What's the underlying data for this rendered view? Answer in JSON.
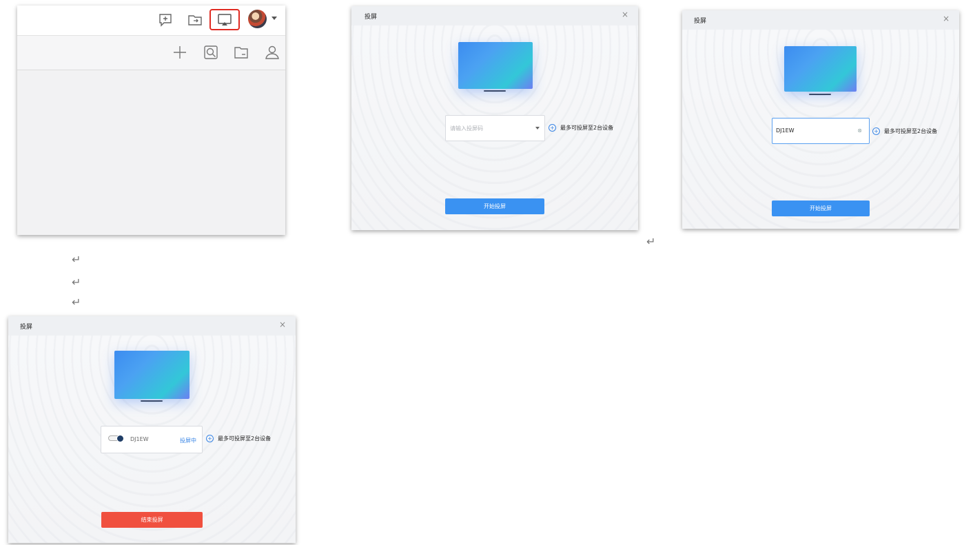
{
  "panel_app": {
    "toolbar_icons": [
      "new-chat-icon",
      "folder-share-icon",
      "screen-cast-icon",
      "avatar",
      "dropdown-caret-icon"
    ],
    "subbar_icons": [
      "plus-icon",
      "search-icon",
      "folder-icon",
      "contacts-icon"
    ]
  },
  "dialog_common": {
    "title": "投屏",
    "close": "×",
    "add_device_label": "最多可投屏至2台设备"
  },
  "dialog_empty": {
    "placeholder": "请输入投屏码",
    "button": "开始投屏"
  },
  "dialog_typed": {
    "value": "DJ1EW",
    "button": "开始投屏"
  },
  "dialog_casting": {
    "device_name": "DJ1EW",
    "status": "投屏中",
    "button": "结束投屏"
  },
  "return_mark": "↵",
  "colors": {
    "accent_blue": "#3a92f2",
    "end_red": "#f0503f",
    "highlight_red": "#e02b22"
  }
}
